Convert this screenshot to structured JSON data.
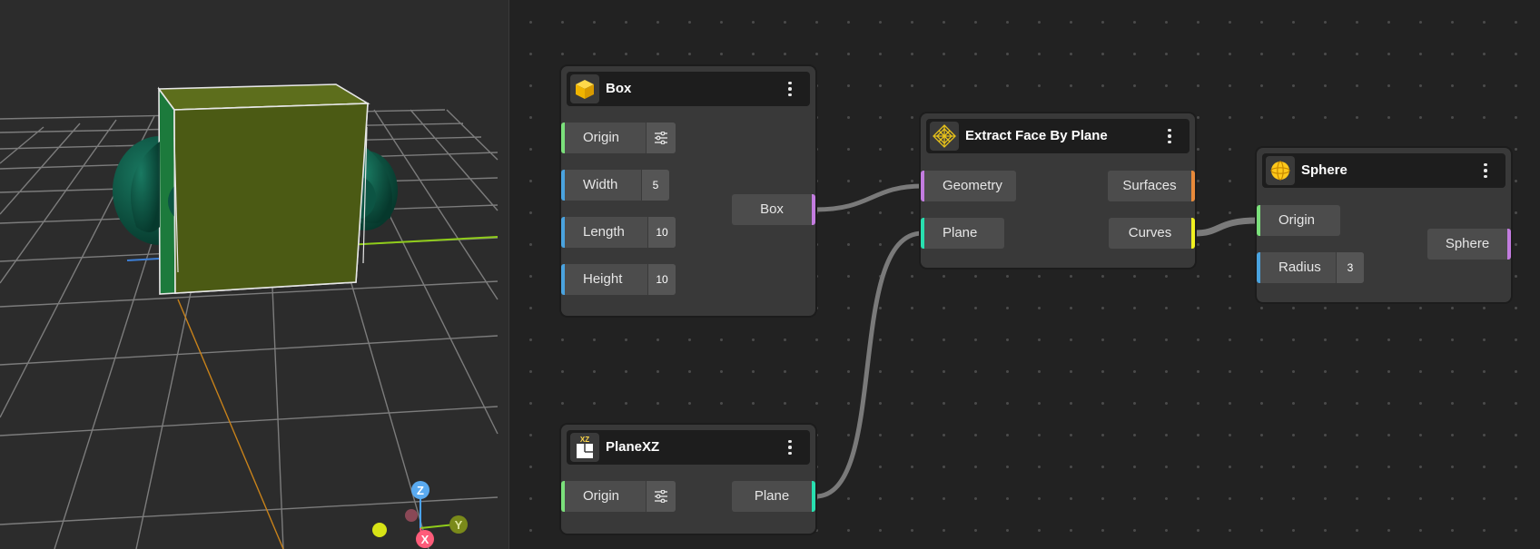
{
  "colors": {
    "graph_bg": "#222222",
    "viewport_bg": "#2c2c2c",
    "node_bg": "#393939",
    "port_green": "#7be07b",
    "port_blue": "#4aa3df",
    "port_violet": "#c37ce0",
    "port_teal": "#28e0b0",
    "port_orange": "#e88a3a",
    "port_yellow": "#f0f020",
    "wire": "#7a7a7a",
    "box_face": "#4b5a14",
    "sphere": "#0e5d4a"
  },
  "viewport": {
    "gizmo": {
      "z": "Z",
      "y": "Y",
      "x": "X"
    }
  },
  "nodes": {
    "box": {
      "title": "Box",
      "icon": "yellow-cube-icon",
      "inputs": [
        {
          "label": "Origin",
          "control": "sliders-icon"
        },
        {
          "label": "Width",
          "value": "5"
        },
        {
          "label": "Length",
          "value": "10"
        },
        {
          "label": "Height",
          "value": "10"
        }
      ],
      "output": "Box"
    },
    "plane_xz": {
      "title": "PlaneXZ",
      "icon": "plane-xz-icon",
      "icon_text": "XZ",
      "inputs": [
        {
          "label": "Origin",
          "control": "sliders-icon"
        }
      ],
      "output": "Plane"
    },
    "extract": {
      "title": "Extract Face By Plane",
      "icon": "extract-face-icon",
      "inputs": [
        {
          "label": "Geometry"
        },
        {
          "label": "Plane"
        }
      ],
      "outputs": [
        {
          "label": "Surfaces"
        },
        {
          "label": "Curves"
        }
      ]
    },
    "sphere": {
      "title": "Sphere",
      "icon": "sphere-icon",
      "inputs": [
        {
          "label": "Origin"
        },
        {
          "label": "Radius",
          "value": "3"
        }
      ],
      "output": "Sphere"
    }
  }
}
